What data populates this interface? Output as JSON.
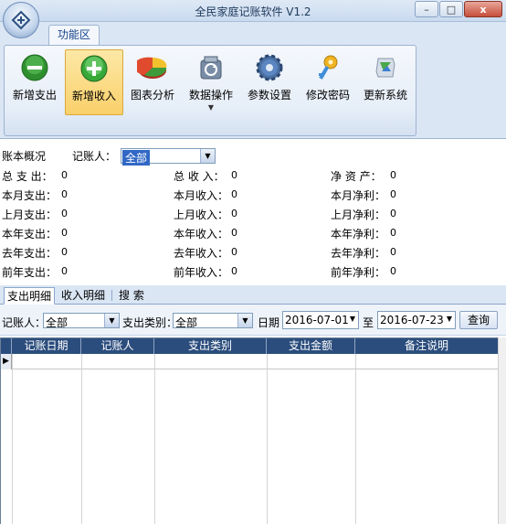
{
  "window": {
    "title": "全民家庭记账软件 V1.2",
    "controls": {
      "minimize": "–",
      "maximize": "□",
      "close": "x"
    }
  },
  "ribbon": {
    "tab_label": "功能区",
    "buttons": [
      {
        "label": "新增支出",
        "icon": "minus-circle-icon",
        "color": "#3a9a3a"
      },
      {
        "label": "新增收入",
        "icon": "plus-circle-icon",
        "color": "#3fb23f",
        "active": true
      },
      {
        "label": "图表分析",
        "icon": "pie-chart-icon"
      },
      {
        "label": "数据操作",
        "icon": "database-refresh-icon",
        "dropdown": true
      },
      {
        "label": "参数设置",
        "icon": "gear-icon"
      },
      {
        "label": "修改密码",
        "icon": "key-icon"
      },
      {
        "label": "更新系统",
        "icon": "update-icon"
      }
    ]
  },
  "summary": {
    "title": "账本概况",
    "recorder_label": "记账人：",
    "recorder_value": "全部",
    "rows": [
      {
        "c1": "总 支 出：",
        "v1": "0",
        "c2": "总 收 入：",
        "v2": "0",
        "c3": "净 资 产：",
        "v3": "0"
      },
      {
        "c1": "本月支出：",
        "v1": "0",
        "c2": "本月收入：",
        "v2": "0",
        "c3": "本月净利：",
        "v3": "0"
      },
      {
        "c1": "上月支出：",
        "v1": "0",
        "c2": "上月收入：",
        "v2": "0",
        "c3": "上月净利：",
        "v3": "0"
      },
      {
        "c1": "本年支出：",
        "v1": "0",
        "c2": "本年收入：",
        "v2": "0",
        "c3": "本年净利：",
        "v3": "0"
      },
      {
        "c1": "去年支出：",
        "v1": "0",
        "c2": "去年收入：",
        "v2": "0",
        "c3": "去年净利：",
        "v3": "0"
      },
      {
        "c1": "前年支出：",
        "v1": "0",
        "c2": "前年收入：",
        "v2": "0",
        "c3": "前年净利：",
        "v3": "0"
      }
    ]
  },
  "tabs": [
    "支出明细",
    "收入明细",
    "搜 索"
  ],
  "filter": {
    "recorder_label": "记账人：",
    "recorder_value": "全部",
    "category_label": "支出类别：",
    "category_value": "全部",
    "date_label": "日期",
    "date_from": "2016-07-01",
    "to_label": "至",
    "date_to": "2016-07-23",
    "query_button": "查询"
  },
  "grid": {
    "columns": [
      "记账日期",
      "记账人",
      "支出类别",
      "支出金额",
      "备注说明"
    ],
    "rows": []
  }
}
